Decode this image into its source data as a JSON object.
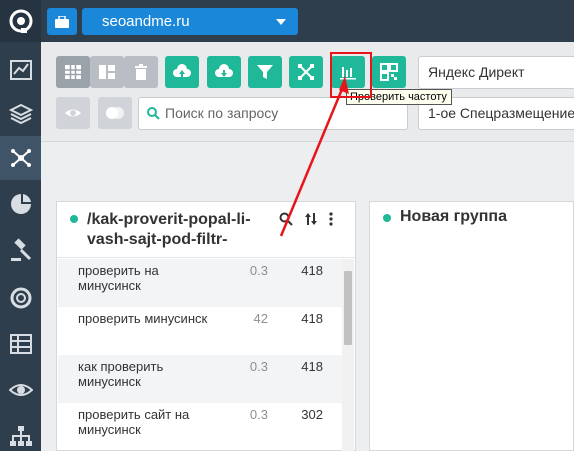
{
  "topbar": {
    "project_name": "seoandme.ru"
  },
  "toolbar": {
    "platform_select": "Яндекс Директ",
    "search_placeholder": "Поиск по запросу",
    "match_select": "1-ое Спецразмещение",
    "tooltip": "Проверить частоту"
  },
  "sidebar": {
    "items": [
      "logo-icon",
      "chart-icon",
      "layers-icon",
      "network-icon",
      "pie-icon",
      "gavel-icon",
      "lifebuoy-icon",
      "table-icon",
      "eye-icon",
      "sitemap-icon"
    ]
  },
  "groups": {
    "left": {
      "title": "/kak-proverit-popal-li-vash-sajt-pod-filtr-",
      "rows": [
        {
          "keyword": "проверить на минусинск",
          "freq": "0.3",
          "count": "418"
        },
        {
          "keyword": "проверить минусинск",
          "freq": "42",
          "count": "418"
        },
        {
          "keyword": "как проверить минусинск",
          "freq": "0.3",
          "count": "418"
        },
        {
          "keyword": "проверить сайт на минусинск",
          "freq": "0.3",
          "count": "302"
        }
      ]
    },
    "right": {
      "title": "Новая группа"
    }
  },
  "colors": {
    "accent_blue": "#1a87d9",
    "accent_green": "#1fb898",
    "sidebar": "#2f3e4c",
    "annotation_red": "#e8141c"
  }
}
